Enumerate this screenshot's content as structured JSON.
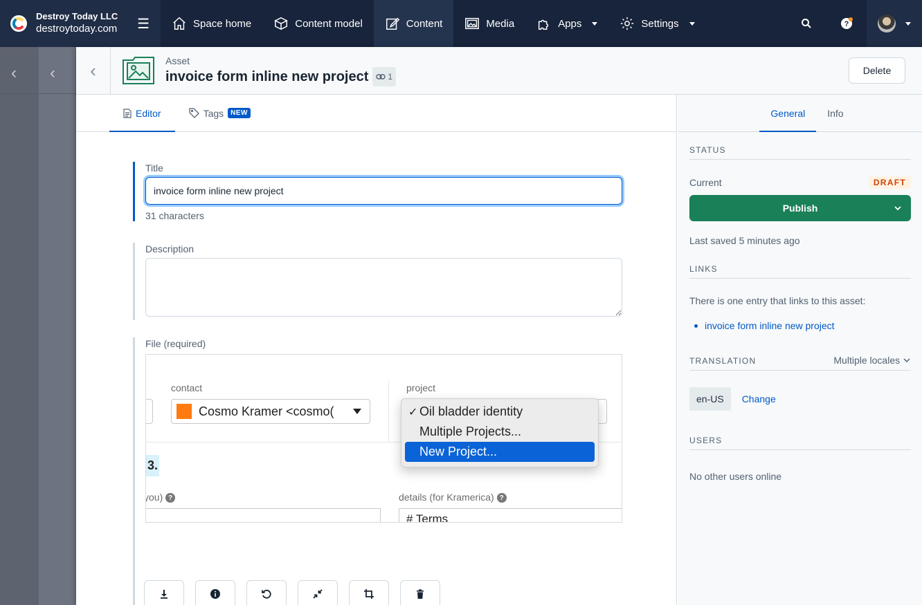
{
  "topbar": {
    "org_name": "Destroy Today LLC",
    "space_name": "destroytoday.com",
    "nav": [
      {
        "label": "Space home",
        "icon": "home-icon"
      },
      {
        "label": "Content model",
        "icon": "cube-icon"
      },
      {
        "label": "Content",
        "icon": "edit-icon"
      },
      {
        "label": "Media",
        "icon": "image-icon"
      },
      {
        "label": "Apps",
        "icon": "puzzle-icon"
      },
      {
        "label": "Settings",
        "icon": "gear-icon"
      }
    ],
    "active_nav": "Content"
  },
  "header": {
    "type_label": "Asset",
    "title": "invoice form inline new project",
    "link_count": "1",
    "delete_label": "Delete"
  },
  "editor": {
    "tabs": [
      {
        "label": "Editor"
      },
      {
        "label": "Tags",
        "badge": "NEW"
      }
    ],
    "title_field": {
      "label": "Title",
      "value": "invoice form inline new project",
      "help": "31 characters"
    },
    "description_field": {
      "label": "Description",
      "value": ""
    },
    "file_field": {
      "label": "File (required)",
      "preview": {
        "contact_label": "contact",
        "contact_value": "Cosmo Kramer <cosmo(",
        "project_label": "project",
        "options": [
          "Oil bladder identity",
          "Multiple Projects...",
          "New Project..."
        ],
        "checked_option": "Oil bladder identity",
        "highlighted_option": "New Project...",
        "badge_text": "3.",
        "left_label": "you)",
        "right_label": "details (for Kramerica)",
        "right_box_text": "# Terms"
      }
    },
    "file_tools": [
      "download-icon",
      "info-icon",
      "rotate-icon",
      "resize-icon",
      "crop-icon",
      "trash-icon"
    ]
  },
  "sidebar": {
    "tabs": [
      {
        "label": "General"
      },
      {
        "label": "Info"
      }
    ],
    "status": {
      "heading": "STATUS",
      "current_label": "Current",
      "badge": "DRAFT",
      "publish_label": "Publish",
      "last_saved": "Last saved 5 minutes ago"
    },
    "links": {
      "heading": "LINKS",
      "text": "There is one entry that links to this asset:",
      "items": [
        "invoice form inline new project"
      ]
    },
    "translation": {
      "heading": "TRANSLATION",
      "locales_label": "Multiple locales",
      "locale": "en-US",
      "change_label": "Change"
    },
    "users": {
      "heading": "USERS",
      "text": "No other users online"
    }
  },
  "colors": {
    "nav_bg": "#18243b",
    "primary": "#0059c8",
    "publish": "#1a8058",
    "draft_text": "#cc4500"
  }
}
